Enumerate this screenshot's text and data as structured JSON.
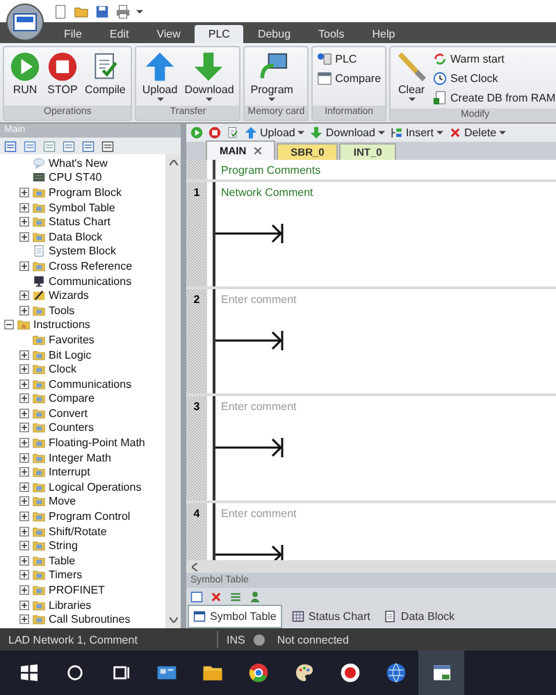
{
  "menu_tabs": [
    {
      "label": "File",
      "selected": false
    },
    {
      "label": "Edit",
      "selected": false
    },
    {
      "label": "View",
      "selected": false
    },
    {
      "label": "PLC",
      "selected": true
    },
    {
      "label": "Debug",
      "selected": false
    },
    {
      "label": "Tools",
      "selected": false
    },
    {
      "label": "Help",
      "selected": false
    }
  ],
  "ribbon_groups": [
    {
      "label": "Operations",
      "buttons": [
        {
          "label": "RUN",
          "kind": "run",
          "dropdown": false
        },
        {
          "label": "STOP",
          "kind": "stop",
          "dropdown": false
        },
        {
          "label": "Compile",
          "kind": "compile",
          "dropdown": false
        }
      ]
    },
    {
      "label": "Transfer",
      "buttons": [
        {
          "label": "Upload",
          "kind": "upload",
          "dropdown": true
        },
        {
          "label": "Download",
          "kind": "download",
          "dropdown": true
        }
      ]
    },
    {
      "label": "Memory card",
      "buttons": [
        {
          "label": "Program",
          "kind": "program",
          "dropdown": true
        }
      ]
    },
    {
      "label": "Information",
      "small_buttons": [
        {
          "label": "PLC",
          "kind": "plc"
        },
        {
          "label": "Compare",
          "kind": "compare"
        }
      ]
    },
    {
      "label": "Modify",
      "buttons": [
        {
          "label": "Clear",
          "kind": "clear",
          "dropdown": true
        }
      ],
      "small_buttons": [
        {
          "label": "Warm start",
          "kind": "warm"
        },
        {
          "label": "Set Clock",
          "kind": "clock"
        },
        {
          "label": "Create DB from RAM",
          "kind": "createdb"
        }
      ]
    }
  ],
  "project_panel": {
    "title": "Main",
    "project_children": [
      {
        "label": "What's New",
        "kind": "bubble"
      },
      {
        "label": "CPU ST40",
        "kind": "cpu"
      },
      {
        "label": "Program Block",
        "kind": "folder",
        "expanded": false
      },
      {
        "label": "Symbol Table",
        "kind": "folder",
        "expanded": false
      },
      {
        "label": "Status Chart",
        "kind": "folder",
        "expanded": false
      },
      {
        "label": "Data Block",
        "kind": "folder",
        "expanded": false
      },
      {
        "label": "System Block",
        "kind": "sheet"
      },
      {
        "label": "Cross Reference",
        "kind": "folder",
        "expanded": false
      },
      {
        "label": "Communications",
        "kind": "monitor"
      },
      {
        "label": "Wizards",
        "kind": "wand",
        "expanded": false
      },
      {
        "label": "Tools",
        "kind": "folder",
        "expanded": false
      }
    ],
    "instructions": {
      "label": "Instructions",
      "kind": "star",
      "expanded": true,
      "children": [
        {
          "label": "Favorites",
          "kind": "folder"
        },
        {
          "label": "Bit Logic",
          "kind": "folder",
          "expanded": false
        },
        {
          "label": "Clock",
          "kind": "folder",
          "expanded": false
        },
        {
          "label": "Communications",
          "kind": "folder",
          "expanded": false
        },
        {
          "label": "Compare",
          "kind": "folder",
          "expanded": false
        },
        {
          "label": "Convert",
          "kind": "folder",
          "expanded": false
        },
        {
          "label": "Counters",
          "kind": "folder",
          "expanded": false
        },
        {
          "label": "Floating-Point Math",
          "kind": "folder",
          "expanded": false
        },
        {
          "label": "Integer Math",
          "kind": "folder",
          "expanded": false
        },
        {
          "label": "Interrupt",
          "kind": "folder",
          "expanded": false
        },
        {
          "label": "Logical Operations",
          "kind": "folder",
          "expanded": false
        },
        {
          "label": "Move",
          "kind": "folder",
          "expanded": false
        },
        {
          "label": "Program Control",
          "kind": "folder",
          "expanded": false
        },
        {
          "label": "Shift/Rotate",
          "kind": "folder",
          "expanded": false
        },
        {
          "label": "String",
          "kind": "folder",
          "expanded": false
        },
        {
          "label": "Table",
          "kind": "folder",
          "expanded": false
        },
        {
          "label": "Timers",
          "kind": "folder",
          "expanded": false
        },
        {
          "label": "PROFINET",
          "kind": "folder",
          "expanded": false
        },
        {
          "label": "Libraries",
          "kind": "folder",
          "expanded": false
        },
        {
          "label": "Call Subroutines",
          "kind": "folder",
          "expanded": false
        }
      ]
    }
  },
  "editor": {
    "toolbar": [
      {
        "kind": "run"
      },
      {
        "kind": "stop"
      },
      {
        "kind": "compile"
      },
      {
        "kind": "upload",
        "label": "Upload",
        "dropdown": true
      },
      {
        "kind": "download",
        "label": "Download",
        "dropdown": true
      },
      {
        "kind": "insert",
        "label": "Insert",
        "dropdown": true
      },
      {
        "kind": "delete",
        "label": "Delete",
        "dropdown": true
      }
    ],
    "tabs": [
      {
        "label": "MAIN",
        "selected": true,
        "closable": true,
        "color": "#f2f4f7"
      },
      {
        "label": "SBR_0",
        "selected": false,
        "closable": false,
        "color": "#f5e07e"
      },
      {
        "label": "INT_0",
        "selected": false,
        "closable": false,
        "color": "#e0efc2"
      }
    ],
    "program_comment": "Program Comments",
    "networks": [
      {
        "number": "1",
        "comment": "Network Comment"
      },
      {
        "number": "2",
        "placeholder": "Enter comment"
      },
      {
        "number": "3",
        "placeholder": "Enter comment"
      },
      {
        "number": "4",
        "placeholder": "Enter comment"
      }
    ]
  },
  "symbol_panel": {
    "title": "Symbol Table",
    "tabs": [
      {
        "label": "Symbol Table",
        "kind": "table",
        "selected": true
      },
      {
        "label": "Status Chart",
        "kind": "chart",
        "selected": false
      },
      {
        "label": "Data Block",
        "kind": "block",
        "selected": false
      }
    ]
  },
  "status_bar": {
    "location": "LAD Network 1, Comment",
    "mode": "INS",
    "connection": "Not connected"
  },
  "taskbar": [
    {
      "kind": "start",
      "active": false
    },
    {
      "kind": "search",
      "active": false
    },
    {
      "kind": "taskview",
      "active": false
    },
    {
      "kind": "news",
      "active": false
    },
    {
      "kind": "files",
      "active": false
    },
    {
      "kind": "browser",
      "active": false
    },
    {
      "kind": "paint",
      "active": false
    },
    {
      "kind": "record",
      "active": false
    },
    {
      "kind": "globe",
      "active": false
    },
    {
      "kind": "app",
      "active": true
    }
  ]
}
